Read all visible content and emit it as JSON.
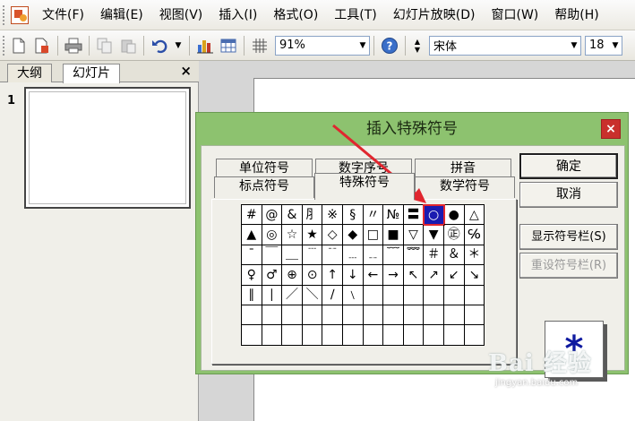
{
  "menubar": {
    "items": [
      "文件(F)",
      "编辑(E)",
      "视图(V)",
      "插入(I)",
      "格式(O)",
      "工具(T)",
      "幻灯片放映(D)",
      "窗口(W)",
      "帮助(H)"
    ]
  },
  "toolbar": {
    "zoom": "91%",
    "font": "宋体",
    "font_size": "18",
    "icons": [
      "new-icon",
      "open-icon",
      "print-icon",
      "copy-icon",
      "paste-icon",
      "undo-icon",
      "chart-icon",
      "table-icon",
      "grid-icon",
      "help-icon"
    ]
  },
  "left_pane": {
    "tabs": [
      "大纲",
      "幻灯片"
    ],
    "close": "×",
    "slide_number": "1"
  },
  "dialog": {
    "title": "插入特殊符号",
    "close": "×",
    "tabs_back": [
      "单位符号",
      "数字序号",
      "拼音"
    ],
    "tabs_front": [
      "标点符号",
      "特殊符号",
      "数学符号"
    ],
    "active_tab": "特殊符号",
    "symbols": [
      [
        "#",
        "@",
        "&",
        "⺼",
        "※",
        "§",
        "〃",
        "№",
        "〓",
        "○",
        "●",
        "△"
      ],
      [
        "▲",
        "◎",
        "☆",
        "★",
        "◇",
        "◆",
        "□",
        "■",
        "▽",
        "▼",
        "㊣",
        "℅"
      ],
      [
        "ˉ",
        "￣",
        "＿",
        "﹉",
        "﹊",
        "﹍",
        "﹎",
        "﹋",
        "﹌",
        "＃",
        "＆",
        "＊"
      ],
      [
        "♀",
        "♂",
        "⊕",
        "⊙",
        "↑",
        "↓",
        "←",
        "→",
        "↖",
        "↗",
        "↙",
        "↘"
      ],
      [
        "∥",
        "∣",
        "／",
        "＼",
        "∕",
        "﹨",
        "",
        "",
        "",
        "",
        "",
        ""
      ],
      [
        "",
        "",
        "",
        "",
        "",
        "",
        "",
        "",
        "",
        "",
        "",
        ""
      ],
      [
        "",
        "",
        "",
        "",
        "",
        "",
        "",
        "",
        "",
        "",
        "",
        ""
      ]
    ],
    "selected_symbol": "○",
    "buttons": {
      "ok": "确定",
      "cancel": "取消",
      "show_bar": "显示符号栏(S)",
      "reset_bar": "重设符号栏(R)"
    },
    "preview_symbol": "*"
  },
  "watermark": {
    "main": "Bai 经验",
    "sub": "jingyan.baidu.com"
  },
  "colors": {
    "dialog_frame": "#8dc26f",
    "selection": "#1a1ab0",
    "highlight": "#e0262f",
    "preview_symbol": "#0f1aa0"
  }
}
